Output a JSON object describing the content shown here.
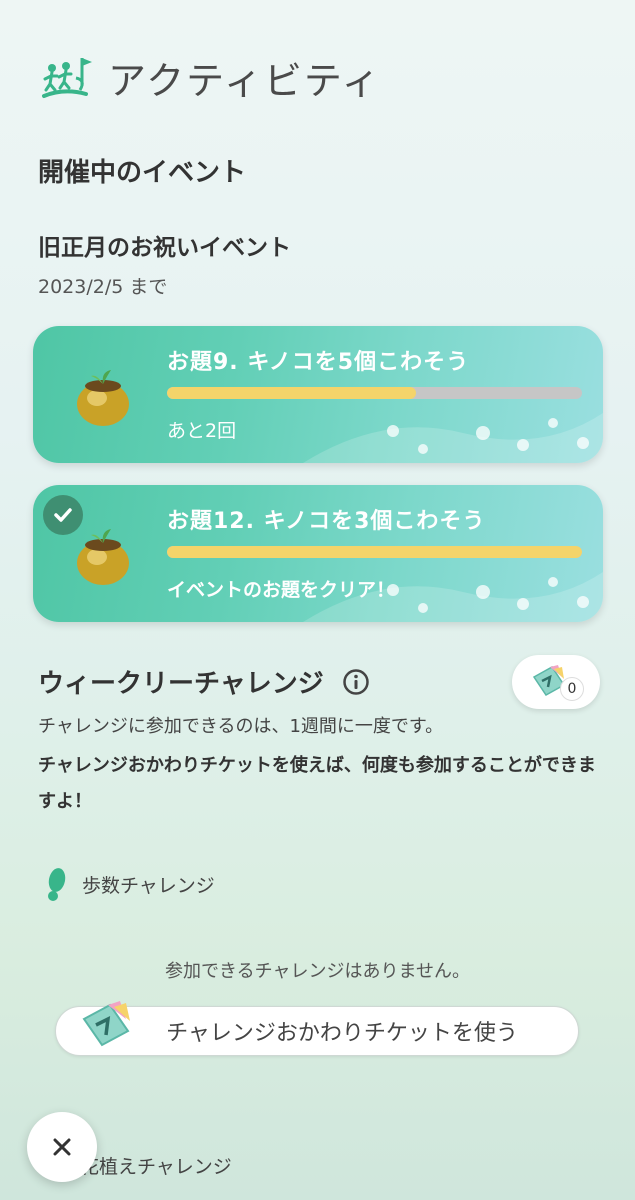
{
  "header": {
    "title": "アクティビティ",
    "icon": "activity-runners-icon"
  },
  "events_section": {
    "title": "開催中のイベント"
  },
  "event": {
    "name": "旧正月のお祝いイベント",
    "date": "2023/2/5 まで",
    "tasks": [
      {
        "title": "お題9. キノコを5個こわそう",
        "progress": 0.6,
        "status": "あと2回",
        "completed": false
      },
      {
        "title": "お題12. キノコを3個こわそう",
        "progress": 1.0,
        "status": "イベントのお題をクリア！",
        "completed": true
      }
    ]
  },
  "weekly": {
    "title": "ウィークリーチャレンジ",
    "ticket_count": "0",
    "desc1": "チャレンジに参加できるのは、1週間に一度です。",
    "desc2": "チャレンジおかわりチケットを使えば、何度も参加することができますよ！"
  },
  "step_challenge": {
    "label": "歩数チャレンジ",
    "empty_text": "参加できるチャレンジはありません。",
    "button_label": "チャレンジおかわりチケットを使う"
  },
  "flower_challenge": {
    "label": "花植えチャレンジ"
  },
  "colors": {
    "card_green": "#4fc6a5",
    "progress_yellow": "#f4d46a",
    "check_green": "#3f8f72"
  }
}
